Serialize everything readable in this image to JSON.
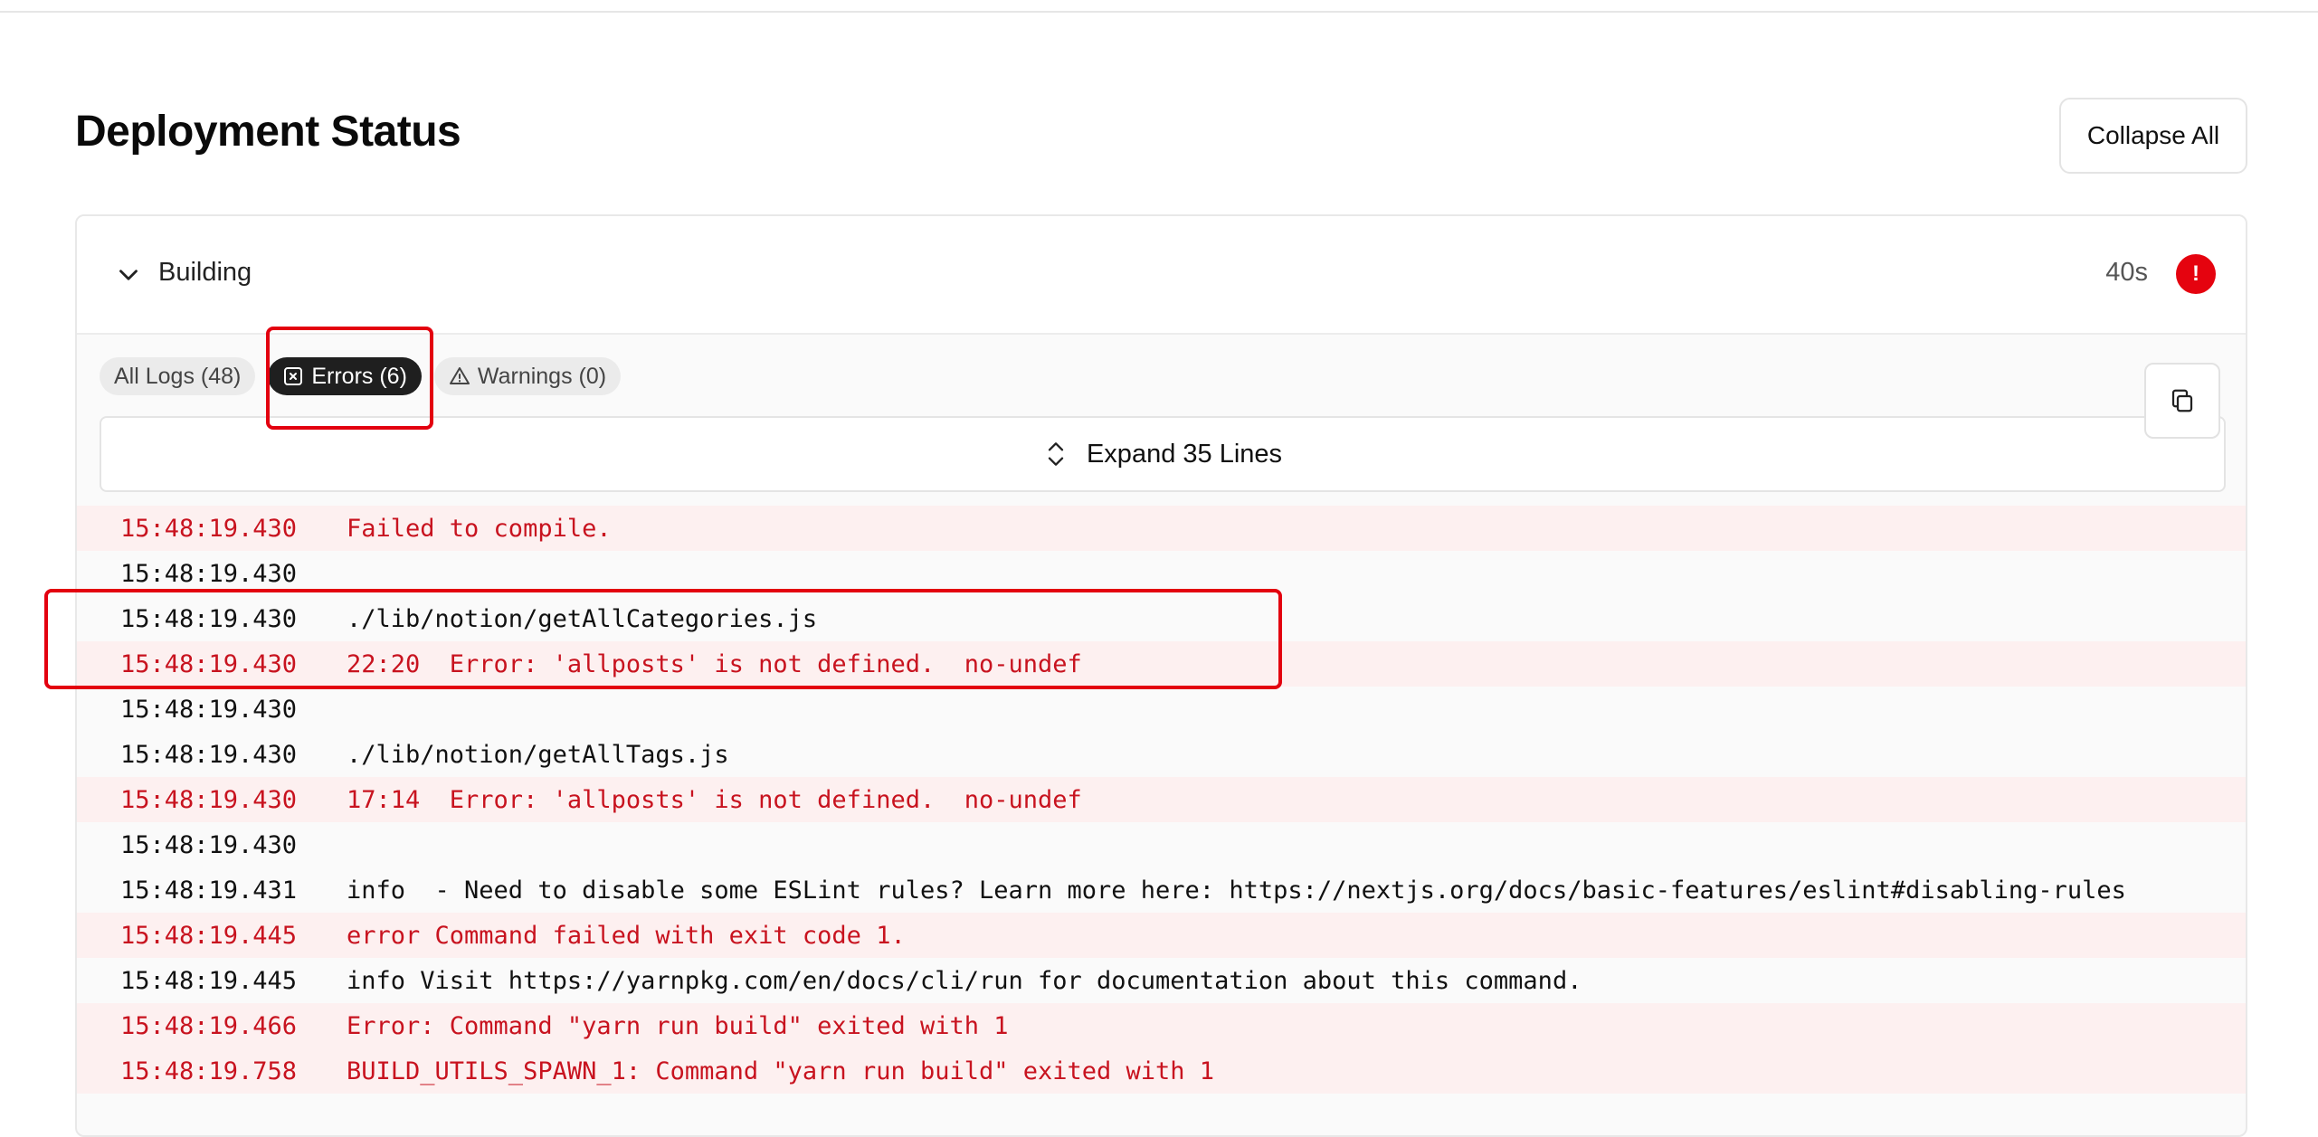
{
  "page": {
    "title": "Deployment Status",
    "collapse_label": "Collapse All"
  },
  "build": {
    "label": "Building",
    "duration": "40s",
    "status_mark": "!"
  },
  "tabs": [
    {
      "label": "All Logs (48)",
      "active": false
    },
    {
      "label": "Errors (6)",
      "active": true
    },
    {
      "label": "Warnings (0)",
      "active": false
    }
  ],
  "expand_label": "Expand 35 Lines",
  "logs": [
    {
      "ts": "15:48:19.430",
      "msg": "Failed to compile.",
      "level": "error"
    },
    {
      "ts": "15:48:19.430",
      "msg": "",
      "level": "info"
    },
    {
      "ts": "15:48:19.430",
      "msg": "./lib/notion/getAllCategories.js",
      "level": "info"
    },
    {
      "ts": "15:48:19.430",
      "msg": "22:20  Error: 'allposts' is not defined.  no-undef",
      "level": "error"
    },
    {
      "ts": "15:48:19.430",
      "msg": "",
      "level": "info"
    },
    {
      "ts": "15:48:19.430",
      "msg": "./lib/notion/getAllTags.js",
      "level": "info"
    },
    {
      "ts": "15:48:19.430",
      "msg": "17:14  Error: 'allposts' is not defined.  no-undef",
      "level": "error"
    },
    {
      "ts": "15:48:19.430",
      "msg": "",
      "level": "info"
    },
    {
      "ts": "15:48:19.431",
      "msg": "info  - Need to disable some ESLint rules? Learn more here: https://nextjs.org/docs/basic-features/eslint#disabling-rules",
      "level": "info"
    },
    {
      "ts": "15:48:19.445",
      "msg": "error Command failed with exit code 1.",
      "level": "error"
    },
    {
      "ts": "15:48:19.445",
      "msg": "info Visit https://yarnpkg.com/en/docs/cli/run for documentation about this command.",
      "level": "info"
    },
    {
      "ts": "15:48:19.466",
      "msg": "Error: Command \"yarn run build\" exited with 1",
      "level": "error"
    },
    {
      "ts": "15:48:19.758",
      "msg": "BUILD_UTILS_SPAWN_1: Command \"yarn run build\" exited with 1",
      "level": "error"
    }
  ],
  "colors": {
    "error_text": "#c8131f",
    "error_bg": "#fdf0f0",
    "status_red": "#e5030f",
    "highlight": "#e3000f"
  }
}
